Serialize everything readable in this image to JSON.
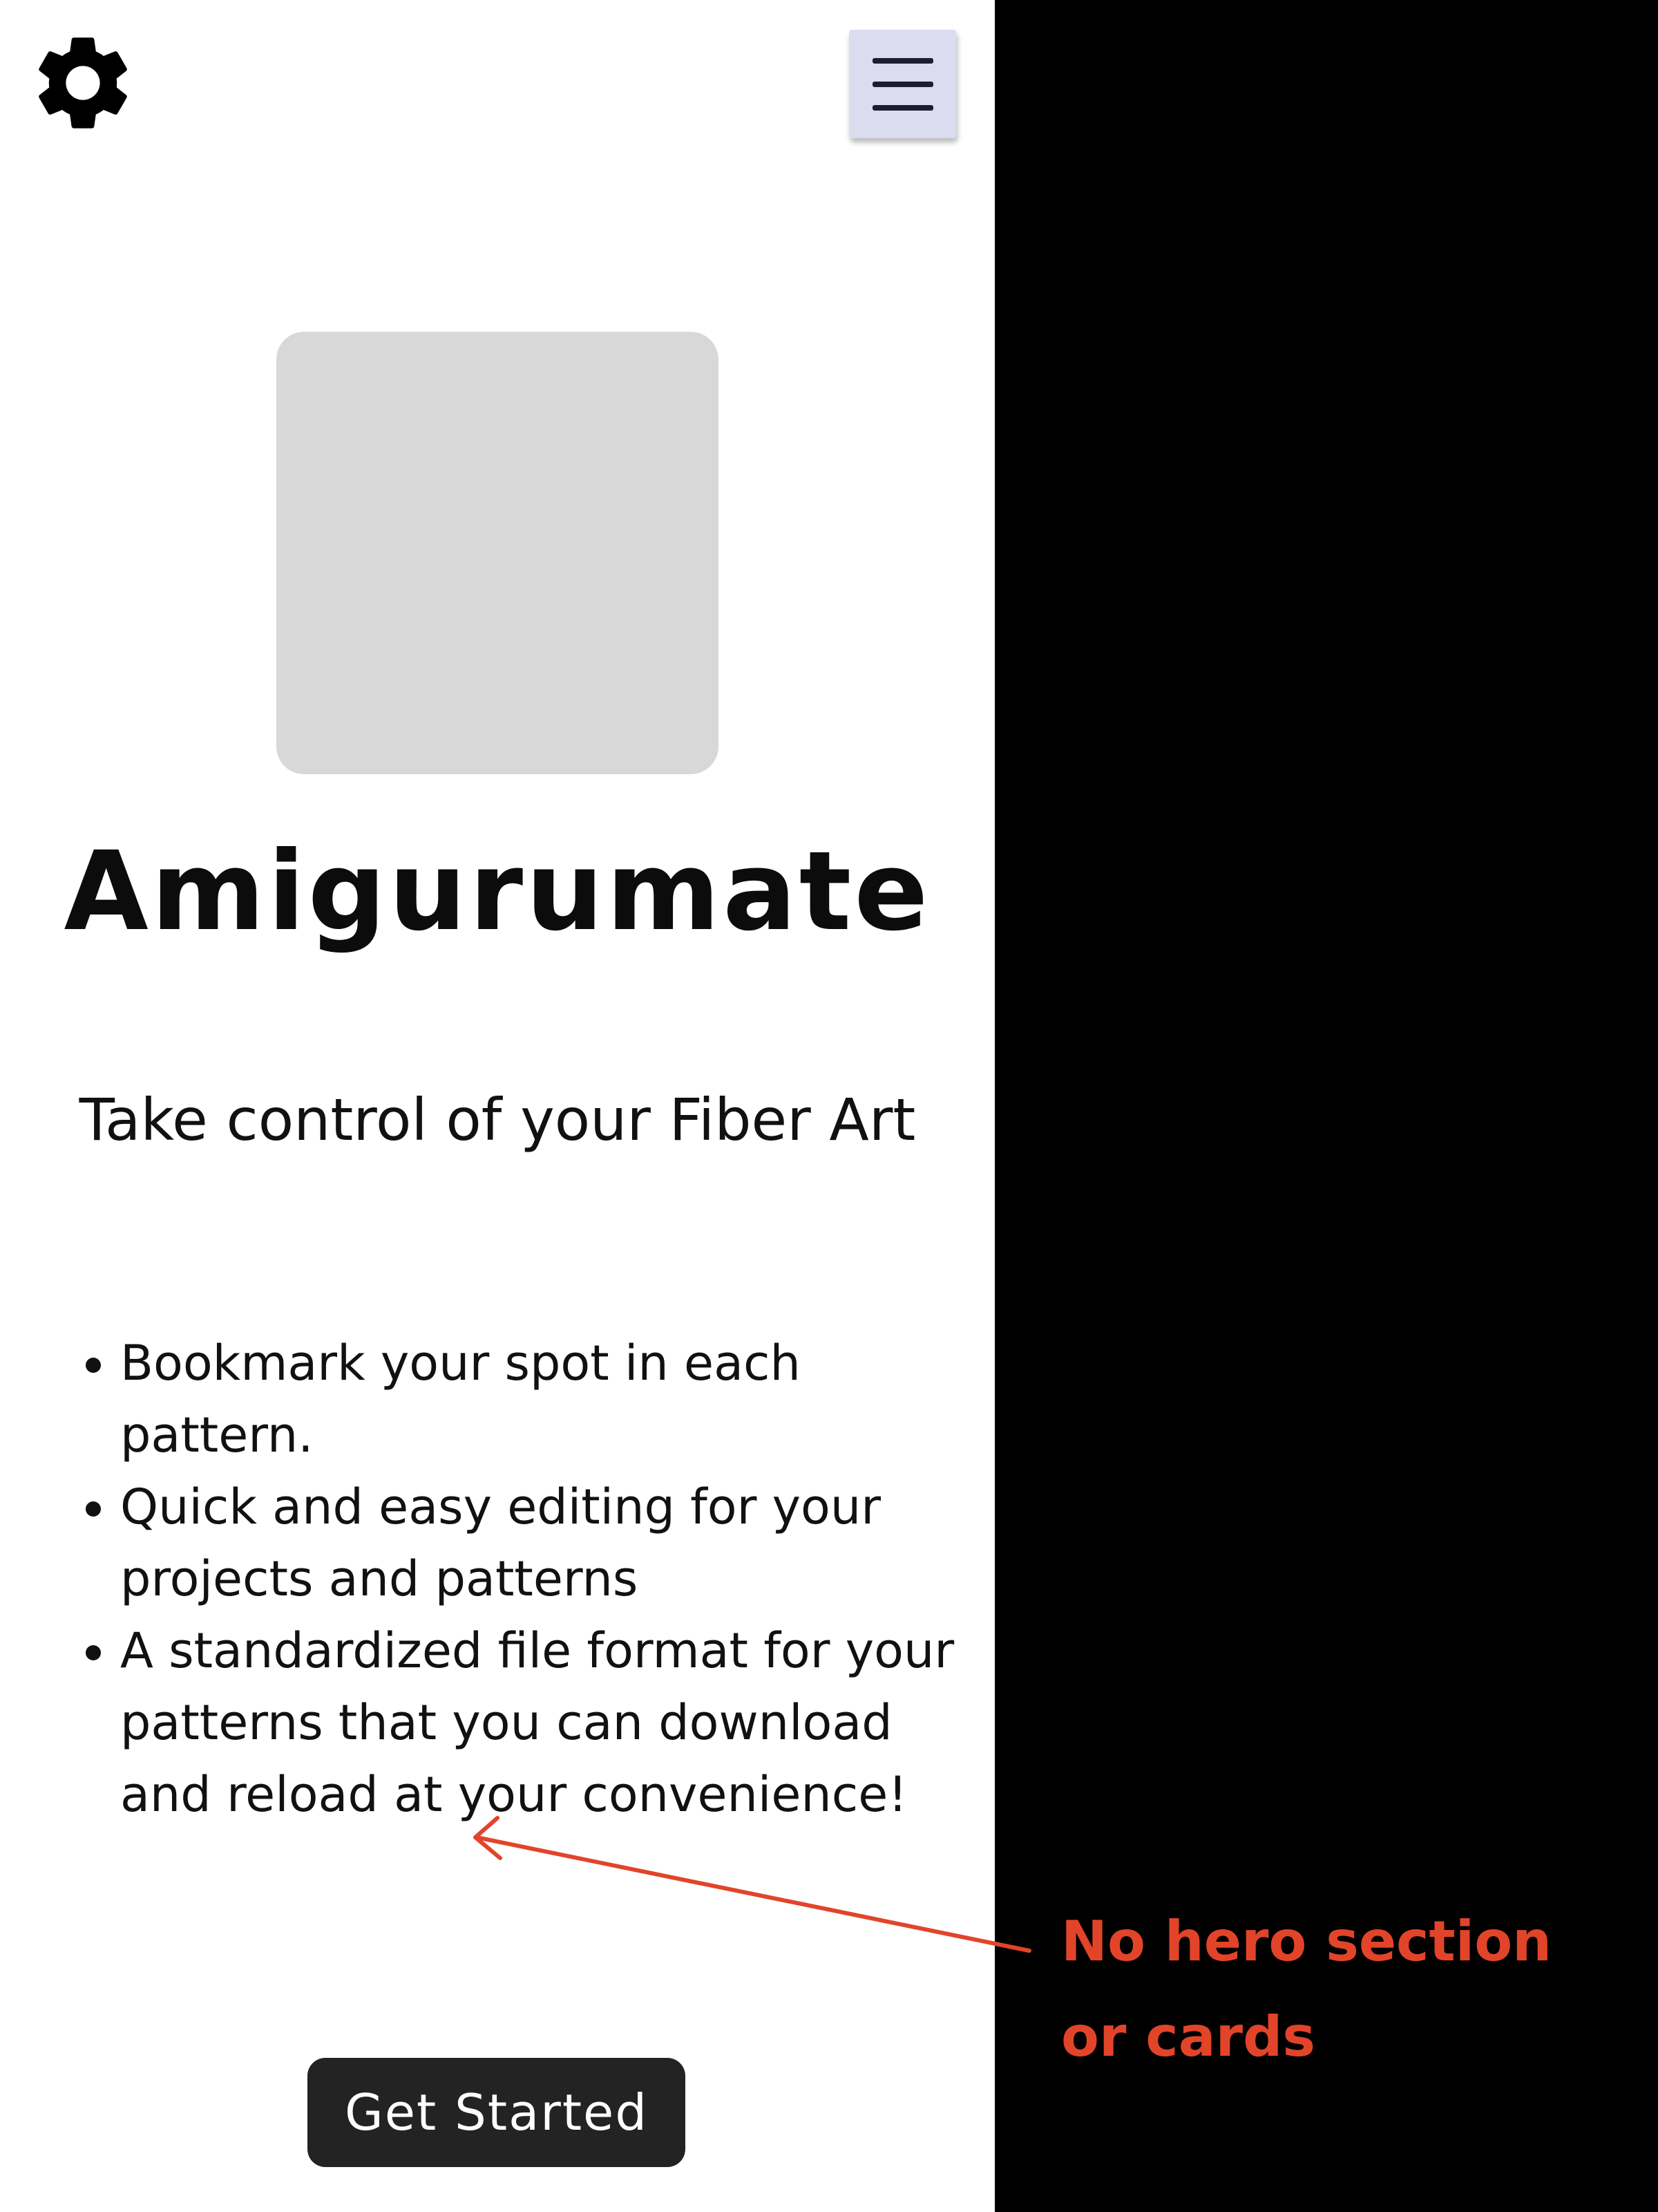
{
  "header": {
    "settings_icon": "gear-icon",
    "menu_icon": "hamburger-menu-icon",
    "menu_button_bg": "#dcdcf0"
  },
  "hero": {
    "logo_placeholder_color": "#d7d8d7",
    "title": "Amigurumate",
    "tagline": "Take control of your Fiber Art"
  },
  "features": [
    "Bookmark your spot in each pattern.",
    "Quick and easy editing for your projects and patterns",
    "A standardized file format for your patterns that you can download and reload at your convenience!"
  ],
  "cta": {
    "label": "Get Started",
    "bg": "#232323"
  },
  "annotation": {
    "text": "No hero section or cards",
    "color": "#e2442a"
  }
}
